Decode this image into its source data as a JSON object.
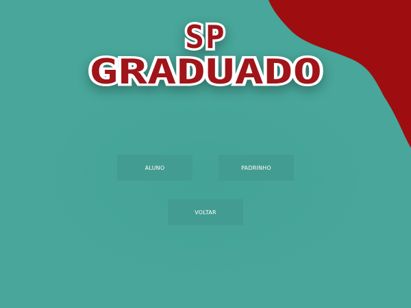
{
  "logo": {
    "line1": "SP",
    "line2": "GRADUADO"
  },
  "buttons": {
    "aluno": "ALUNO",
    "padrinho": "PADRINHO",
    "voltar": "VOLTAR"
  },
  "colors": {
    "background": "#48a69a",
    "accent_red": "#9e0d10",
    "button_bg": "#439c91",
    "button_text": "#ffffff",
    "logo_fill": "#a01519",
    "logo_outline": "#ffffff"
  }
}
